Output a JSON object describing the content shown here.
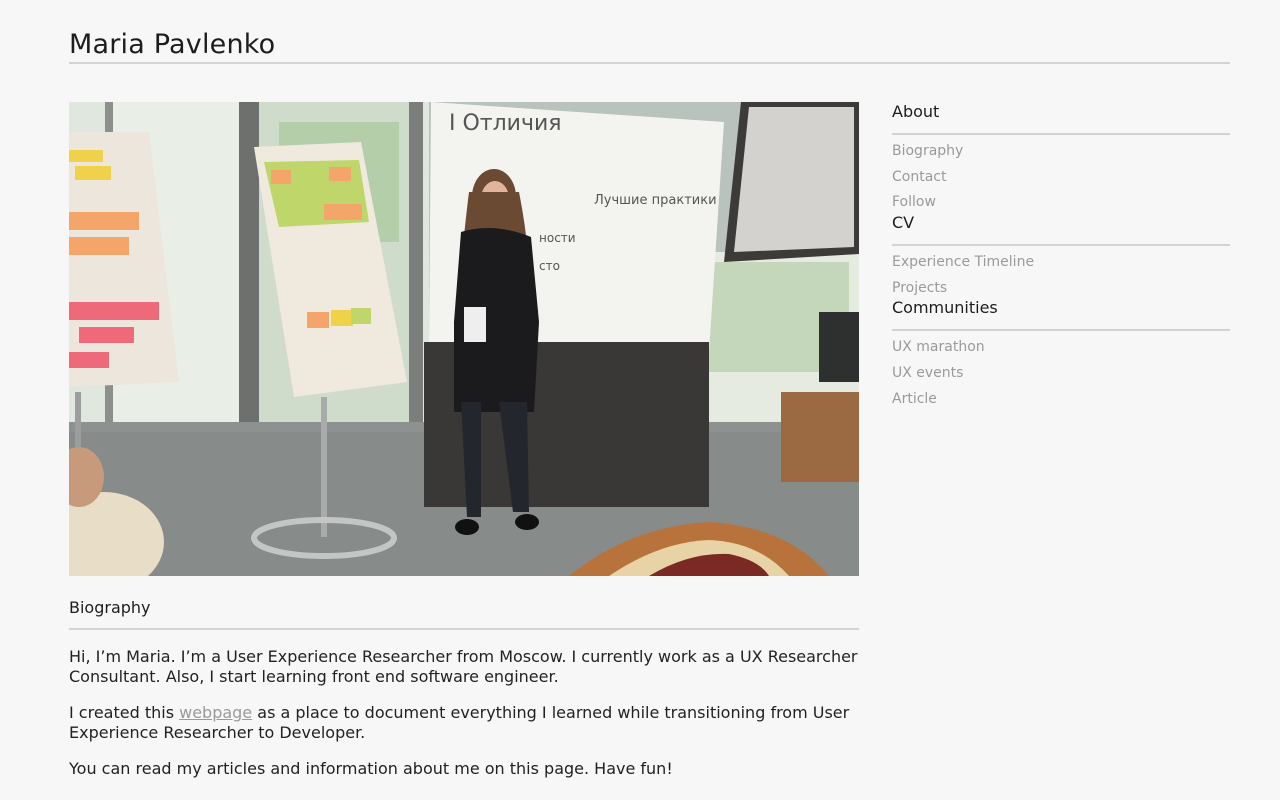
{
  "header": {
    "title": "Maria Pavlenko"
  },
  "hero": {
    "alt": "Maria presenting in front of flipcharts and a whiteboard",
    "whiteboard_text_1": "I Отличия",
    "whiteboard_text_2": "Лучшие практики",
    "whiteboard_text_3": "ности",
    "whiteboard_text_4": "сто"
  },
  "main": {
    "section_title": "Biography",
    "paragraphs": [
      "Hi, I’m Maria. I’m a User Experience Researcher from Moscow. I currently work as a UX Researcher Consultant. Also, I start learning front end software engineer.",
      "You can read my articles and information about me on this page. Have fun!"
    ],
    "p2_before": "I created this ",
    "p2_link": "webpage",
    "p2_after": " as a place to document everything I learned while transitioning from User Experience Researcher to Developer."
  },
  "sidebar": {
    "groups": [
      {
        "title": "About",
        "items": [
          "Biography",
          "Contact",
          "Follow"
        ]
      },
      {
        "title": "CV",
        "items": [
          "Experience Timeline",
          "Projects"
        ]
      },
      {
        "title": "Communities",
        "items": [
          "UX marathon",
          "UX events",
          "Article"
        ]
      }
    ]
  },
  "colors": {
    "background": "#f7f7f7",
    "text": "#222222",
    "muted": "#9a9a9a",
    "rule": "#d3d3d3"
  }
}
